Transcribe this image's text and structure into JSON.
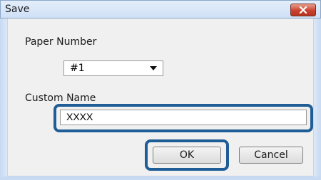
{
  "window": {
    "title": "Save"
  },
  "paper_number": {
    "label": "Paper Number",
    "selected": "#1"
  },
  "custom_name": {
    "label": "Custom Name",
    "value": "XXXX"
  },
  "buttons": {
    "ok": "OK",
    "cancel": "Cancel"
  },
  "colors": {
    "highlight": "#1f5d96",
    "close_button": "#c9412e"
  },
  "icons": {
    "close": "close-icon",
    "dropdown": "chevron-down-icon"
  }
}
